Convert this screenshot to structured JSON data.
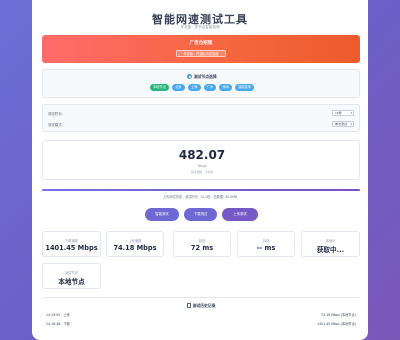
{
  "page": {
    "title": "智能网速测试工具",
    "subtitle": "专业版 · 多节点智能检测"
  },
  "ad": {
    "title": "广告位招租",
    "button": "专享版 · 开通后为您加速"
  },
  "nodes": {
    "heading": "测试节点选择",
    "items": [
      {
        "label": "本地节点",
        "active": true
      },
      {
        "label": "北京",
        "active": false
      },
      {
        "label": "上海",
        "active": false
      },
      {
        "label": "广州",
        "active": false
      },
      {
        "label": "深圳",
        "active": false
      },
      {
        "label": "智能选择",
        "active": false
      }
    ]
  },
  "settings": {
    "duration_label": "测试时长:",
    "duration_value": "10秒",
    "mode_label": "测试模式:",
    "mode_value": "单次测试"
  },
  "speed": {
    "value": "482.07",
    "unit": "Mbps",
    "status": "实时测速 · 平均值"
  },
  "progress": {
    "text": "上传测试完成 - 测试时长: 10.2秒，总数据: 95.0MB",
    "percent": 100
  },
  "buttons": {
    "smart": "智能测试",
    "download": "下载测试",
    "upload": "上传测试"
  },
  "stats": [
    {
      "label": "下载速度",
      "value": "1401.45 Mbps"
    },
    {
      "label": "上传速度",
      "value": "74.18 Mbps"
    },
    {
      "label": "延迟",
      "value": "72 ms"
    },
    {
      "label": "抖动",
      "value": "-- ms"
    },
    {
      "label": "本地IP",
      "value": "获取中..."
    },
    {
      "label": "测试节点",
      "value": "本地节点"
    }
  ],
  "history": {
    "title": "测试历史记录",
    "rows": [
      {
        "left": "14:19:00 - 上传",
        "right": "74.18 Mbps (本地节点)"
      },
      {
        "left": "14:18:48 - 下载",
        "right": "1401.45 Mbps (本地节点)"
      }
    ]
  },
  "colors": {
    "ad_gradient_start": "#ff6b6b",
    "ad_gradient_end": "#ee5a2b",
    "chip_active": "#28b57a",
    "chip_inactive": "#4aa8f0",
    "button_primary": "#6e68d2",
    "button_upload": "#7758c6"
  }
}
